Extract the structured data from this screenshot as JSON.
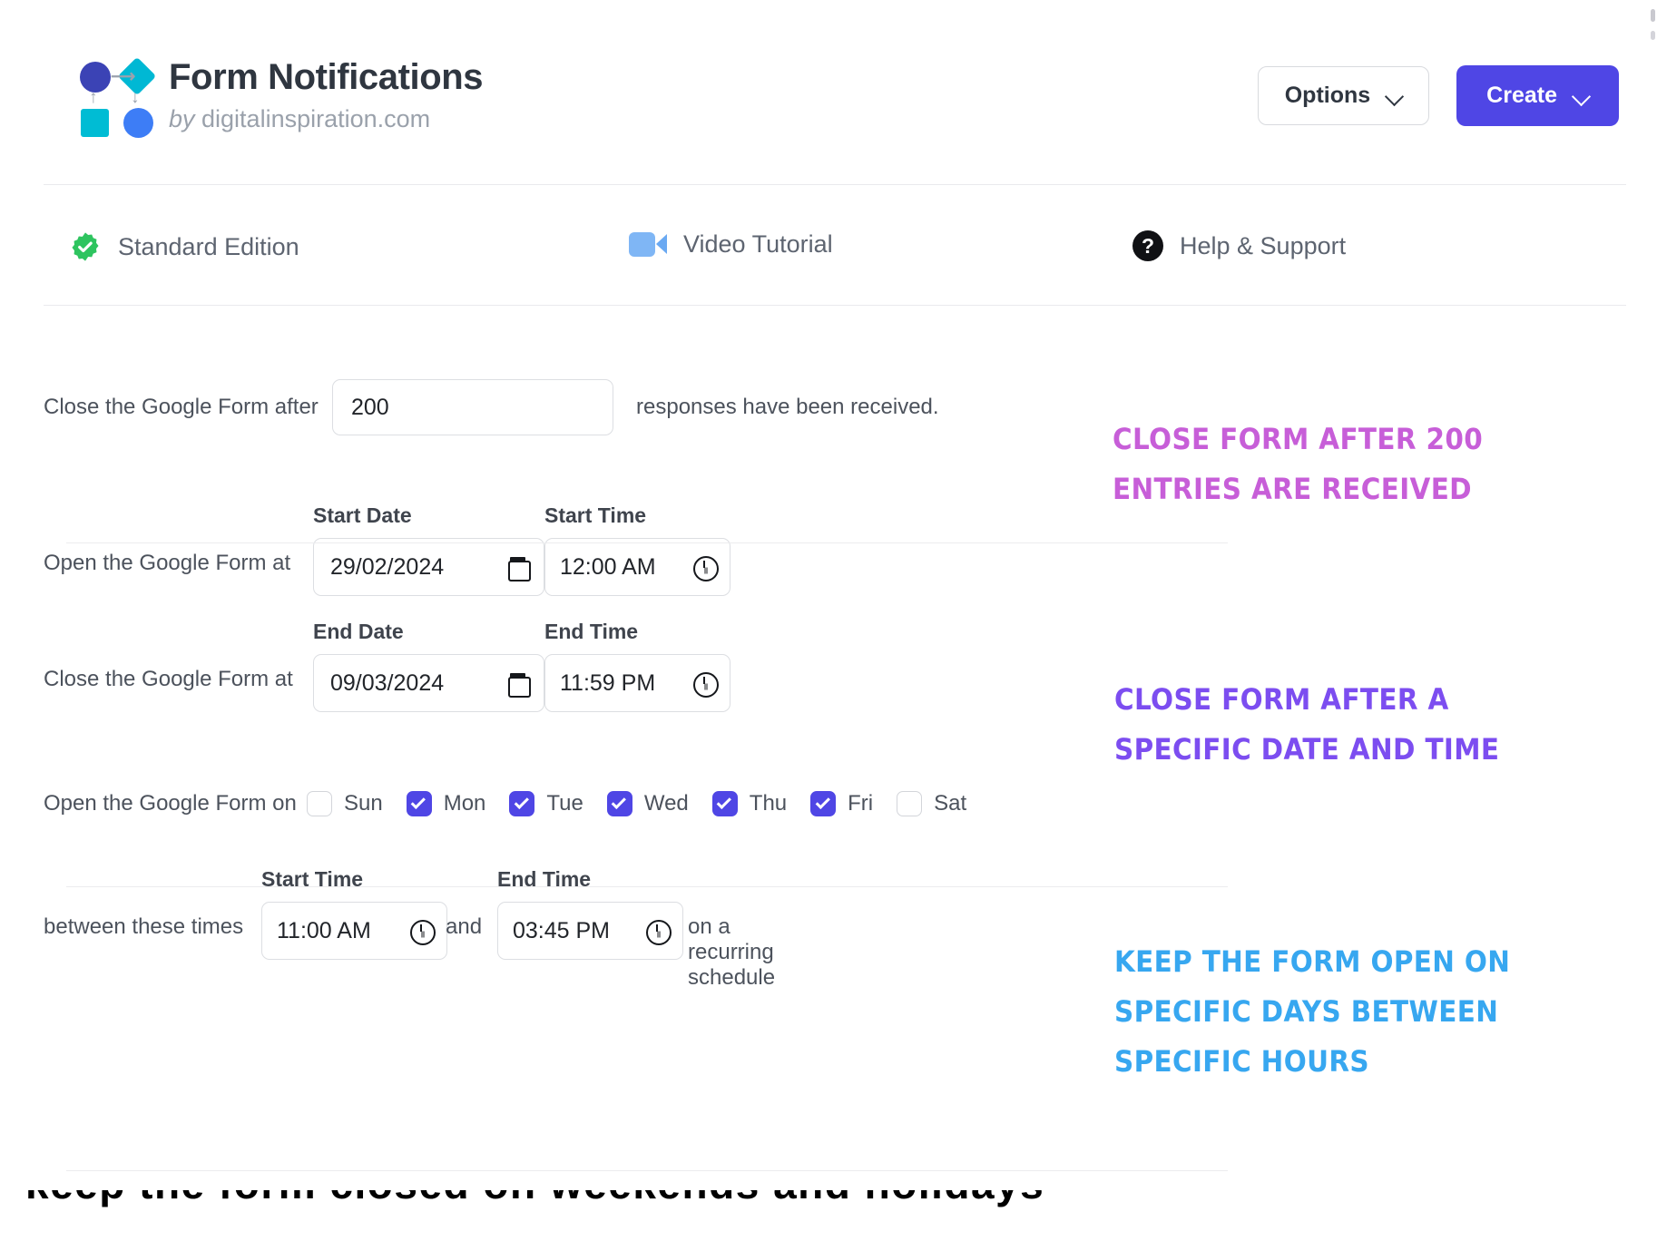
{
  "header": {
    "title": "Form Notifications",
    "byline_prefix": "by ",
    "byline_domain": "digitalinspiration.com",
    "logo_icon": "workflow-nodes-icon",
    "options_button": "Options",
    "create_button": "Create",
    "chevron_icon": "chevron-down-icon"
  },
  "nav": {
    "items": [
      {
        "label": "Standard Edition",
        "icon": "verified-badge-icon",
        "color": "#2ec45f"
      },
      {
        "label": "Video Tutorial",
        "icon": "video-camera-icon",
        "color": "#7fb6f5"
      },
      {
        "label": "Help & Support",
        "icon": "question-mark-circle-icon",
        "color": "#101114"
      }
    ]
  },
  "form": {
    "response_limit": {
      "label_before": "Close the Google Form after",
      "value": "200",
      "label_after": "responses have been received."
    },
    "open_at": {
      "row_label": "Open the Google Form at",
      "date_label": "Start Date",
      "date_value": "29/02/2024",
      "time_label": "Start Time",
      "time_value": "12:00 AM",
      "calendar_icon": "calendar-icon",
      "clock_icon": "clock-icon"
    },
    "close_at": {
      "row_label": "Close the Google Form at",
      "date_label": "End Date",
      "date_value": "09/03/2024",
      "time_label": "End Time",
      "time_value": "11:59 PM",
      "calendar_icon": "calendar-icon",
      "clock_icon": "clock-icon"
    },
    "weekdays": {
      "row_label": "Open the Google Form on",
      "days": [
        {
          "label": "Sun",
          "checked": false
        },
        {
          "label": "Mon",
          "checked": true
        },
        {
          "label": "Tue",
          "checked": true
        },
        {
          "label": "Wed",
          "checked": true
        },
        {
          "label": "Thu",
          "checked": true
        },
        {
          "label": "Fri",
          "checked": true
        },
        {
          "label": "Sat",
          "checked": false
        }
      ],
      "checked_color": "#4f46e5"
    },
    "recurring_times": {
      "row_label": "between these times",
      "start_label": "Start Time",
      "start_value": "11:00 AM",
      "conjunction": "and",
      "end_label": "End Time",
      "end_value": "03:45 PM",
      "tail_label": "on a recurring schedule",
      "clock_icon": "clock-icon"
    }
  },
  "annotations": [
    {
      "text": "Close form after 200\nentries are received",
      "color": "#c75ed8"
    },
    {
      "text": "Close form after a\nspecific date and time",
      "color": "#7c4df0"
    },
    {
      "text": "Keep the form open on\nspecific days between\nspecific hours",
      "color": "#37a7f0"
    }
  ],
  "bottom_clipped_text": "keep the form closed on weekends and holidays"
}
